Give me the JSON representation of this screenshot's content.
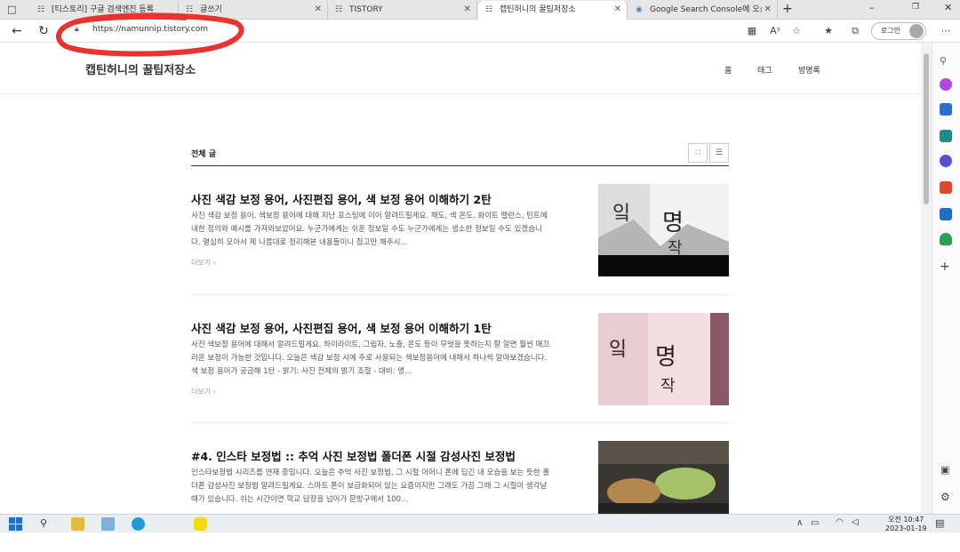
{
  "tabs": [
    {
      "label": "[티스토리] 구글 검색엔진 등록",
      "active": false
    },
    {
      "label": "글쓰기",
      "active": false
    },
    {
      "label": "TISTORY",
      "active": false
    },
    {
      "label": "캡틴허니의 꿀팁저장소",
      "active": true
    },
    {
      "label": "Google Search Console에 오신 것을",
      "active": false
    }
  ],
  "address": {
    "url": "https://namunnip.tistory.com"
  },
  "browser": {
    "login_label": "로그인"
  },
  "blog": {
    "title": "캡틴허니의 꿀팁저장소",
    "nav": [
      "홈",
      "태그",
      "방명록"
    ],
    "list_heading": "전체 글",
    "more_label": "더보기",
    "posts": [
      {
        "title": "사진 색감 보정 용어, 사진편집 용어, 색 보정 용어 이해하기 2탄",
        "excerpt": "사진 색감 보정 용어, 색보정 용어에 대해 지난 포스팅에 이어 알려드릴게요. 채도, 색 온도, 화이트 밸런스, 틴트에 내한 정의와 예시를 가져와보았어요. 누군가에게는 쉬운 정보일 수도 누군가에게는 생소한 정보일 수도 있겠습니다. 열심히 모아서 제 나름대로 정리해본 내용들이니 참고만 해주시..."
      },
      {
        "title": "사진 색감 보정 용어, 사진편집 용어, 색 보정 용어 이해하기 1탄",
        "excerpt": "사진 색보정 용어에 대해서 알려드릴게요. 하이라이트, 그림자, 노출, 온도 등이 무엇을 뜻하는지 잘 알면 훨씬 매끄러운 보정이 가능한 것입니다. 오늘은 색감 보정 시에 주로 사용되는 색보정용어에 내해서 하나씩 알아보겠습니다. 색 보정 용어가 궁금해 1탄 - 밝기: 사진 전체의 밝기 조절 - 대비: 명..."
      },
      {
        "title": "#4. 인스타 보정법 :: 추억 사진 보정법 폴더폰 시절 감성사진 보정법",
        "excerpt": "인스타보정법 시리즈를 연재 중입니다. 오늘은 추억 사진 보정법, 그 시절 어머니 폰에 딥긴 내 모습을 보는 듯한 폴더폰 감성사진 보정법 알려드릴게요. 스마트 폰이 보급화되어 있는 요즘이지만 그래도 가끔 그때 그 시절이 생각날 때가 있습니다. 쉬는 시간이면 학교 담장을 넘어가 문방구에서 100..."
      }
    ]
  },
  "taskbar": {
    "time": "오전 10:47",
    "date": "2023-01-19"
  },
  "colors": {
    "annotation": "#e8332f",
    "tab_bg": "#e6e6e6",
    "taskbar_bg": "#e9eef3"
  }
}
